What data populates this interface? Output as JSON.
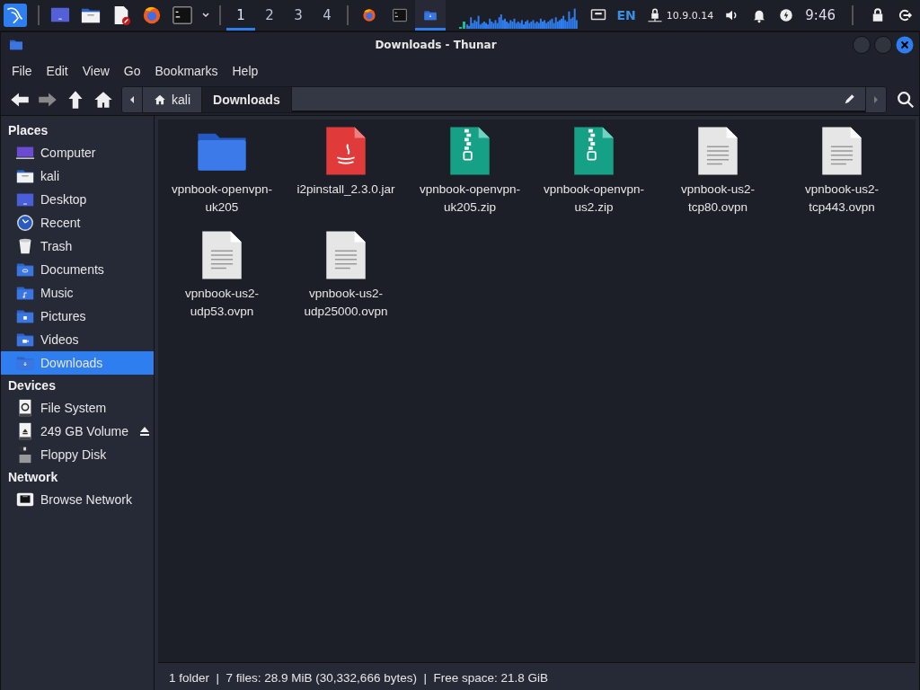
{
  "taskbar": {
    "launchers": [
      {
        "kind": "desktop"
      },
      {
        "kind": "files"
      },
      {
        "kind": "editor"
      },
      {
        "kind": "browser"
      },
      {
        "kind": "terminal"
      }
    ],
    "workspaces": [
      {
        "label": "1",
        "selected": true
      },
      {
        "label": "2",
        "selected": false
      },
      {
        "label": "3",
        "selected": false
      },
      {
        "label": "4",
        "selected": false
      }
    ],
    "tasks": [
      {
        "kind": "browser",
        "selected": false
      },
      {
        "kind": "terminal",
        "selected": false
      },
      {
        "kind": "downloads",
        "selected": true
      }
    ],
    "keyboard_layout": "EN",
    "vpn_address": "10.9.0.14",
    "clock": "9:46"
  },
  "window": {
    "title": "Downloads - Thunar"
  },
  "menu": [
    "File",
    "Edit",
    "View",
    "Go",
    "Bookmarks",
    "Help"
  ],
  "path_bar": [
    {
      "label": "kali",
      "kind": "home",
      "selected": false
    },
    {
      "label": "Downloads",
      "kind": "folder",
      "selected": true
    }
  ],
  "sidebar": [
    {
      "heading": "Places",
      "items": [
        {
          "label": "Computer",
          "kind": "computer",
          "selected": false
        },
        {
          "label": "kali",
          "kind": "home",
          "selected": false
        },
        {
          "label": "Desktop",
          "kind": "desktop",
          "selected": false
        },
        {
          "label": "Recent",
          "kind": "recent",
          "selected": false
        },
        {
          "label": "Trash",
          "kind": "trash",
          "selected": false
        },
        {
          "label": "Documents",
          "kind": "documents",
          "selected": false
        },
        {
          "label": "Music",
          "kind": "music",
          "selected": false
        },
        {
          "label": "Pictures",
          "kind": "pictures",
          "selected": false
        },
        {
          "label": "Videos",
          "kind": "videos",
          "selected": false
        },
        {
          "label": "Downloads",
          "kind": "downloads",
          "selected": true
        }
      ]
    },
    {
      "heading": "Devices",
      "items": [
        {
          "label": "File System",
          "kind": "drive",
          "selected": false
        },
        {
          "label": "249 GB Volume",
          "kind": "volume",
          "selected": false,
          "ejectable": true
        },
        {
          "label": "Floppy Disk",
          "kind": "floppy",
          "selected": false
        }
      ]
    },
    {
      "heading": "Network",
      "items": [
        {
          "label": "Browse Network",
          "kind": "network",
          "selected": false
        }
      ]
    }
  ],
  "files": [
    {
      "name": "vpnbook-openvpn-uk205",
      "kind": "folder"
    },
    {
      "name": "i2pinstall_2.3.0.jar",
      "kind": "jar"
    },
    {
      "name": "vpnbook-openvpn-uk205.zip",
      "kind": "zip"
    },
    {
      "name": "vpnbook-openvpn-us2.zip",
      "kind": "zip"
    },
    {
      "name": "vpnbook-us2-tcp80.ovpn",
      "kind": "text"
    },
    {
      "name": "vpnbook-us2-tcp443.ovpn",
      "kind": "text"
    },
    {
      "name": "vpnbook-us2-udp53.ovpn",
      "kind": "text"
    },
    {
      "name": "vpnbook-us2-udp25000.ovpn",
      "kind": "text"
    }
  ],
  "status_bar": "1 folder  |  7 files: 28.9 MiB (30,332,666 bytes)  |  Free space: 21.8 GiB"
}
